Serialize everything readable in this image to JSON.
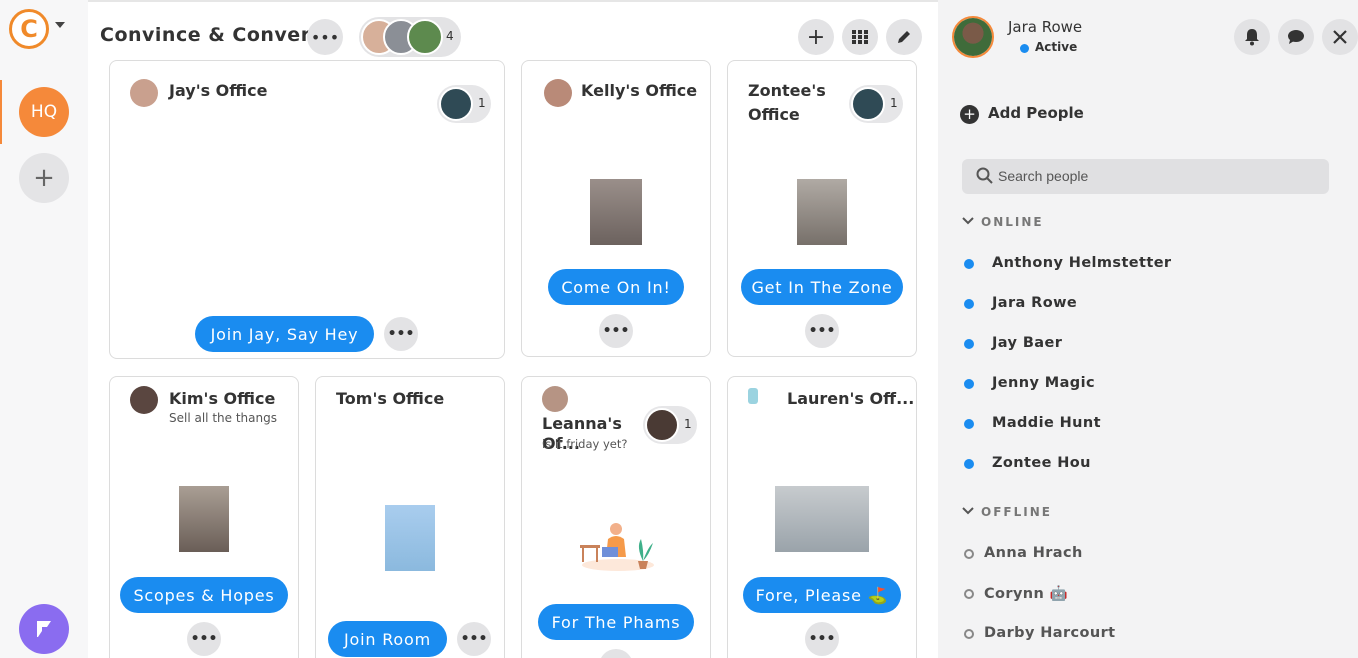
{
  "workspace": {
    "title": "Convince & Convert",
    "member_count": "4",
    "rail": {
      "hq_label": "HQ",
      "add_label": "+"
    }
  },
  "toolbar": {
    "more_label": "•••",
    "add_label": "+",
    "grid_label": "grid",
    "edit_label": "edit"
  },
  "rooms": [
    {
      "title": "Jay's Office",
      "subtitle": "",
      "occupants": "1",
      "button": "Join Jay, Say Hey"
    },
    {
      "title": "Kelly's Office",
      "subtitle": "",
      "occupants": "",
      "button": "Come On In!"
    },
    {
      "title": "Zontee's Office",
      "subtitle": "",
      "occupants": "1",
      "button": "Get In The Zone"
    },
    {
      "title": "Kim's Office",
      "subtitle": "Sell all the thangs",
      "occupants": "",
      "button": "Scopes & Hopes"
    },
    {
      "title": "Tom's Office",
      "subtitle": "",
      "occupants": "",
      "button": "Join Room"
    },
    {
      "title": "Leanna's Of...",
      "subtitle": "is it friday yet?",
      "occupants": "1",
      "button": "For The Phams"
    },
    {
      "title": "Lauren's Off...",
      "subtitle": "",
      "occupants": "",
      "button": "Fore, Please ⛳"
    }
  ],
  "more_dots": "•••",
  "panel": {
    "user_name": "Jara Rowe",
    "user_status": "Active",
    "add_people": "Add People",
    "search_placeholder": "Search people",
    "online_header": "ONLINE",
    "offline_header": "OFFLINE",
    "online": [
      "Anthony Helmstetter",
      "Jara Rowe",
      "Jay Baer",
      "Jenny Magic",
      "Maddie Hunt",
      "Zontee Hou"
    ],
    "offline": [
      "Anna Hrach",
      "Corynn 🤖",
      "Darby Harcourt"
    ]
  },
  "colors": {
    "accent": "#1a8cf0",
    "brand": "#f5893a",
    "app_badge": "#8a6cf0"
  }
}
